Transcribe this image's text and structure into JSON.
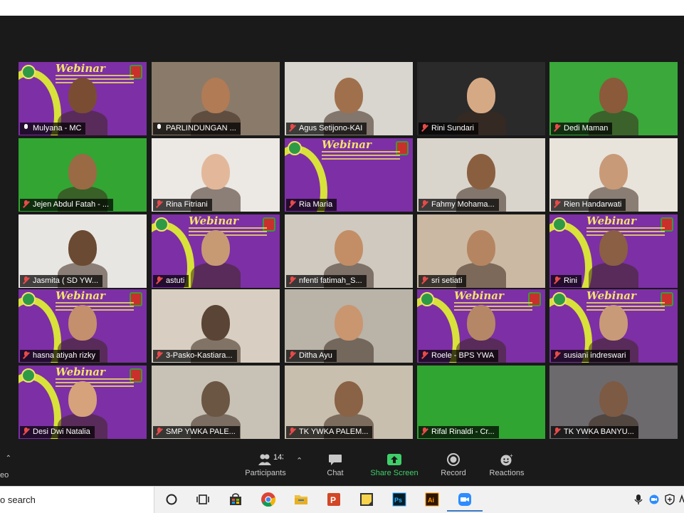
{
  "participants": [
    {
      "name": "Mulyana - MC",
      "mic": "on",
      "bg": "#7d2fa5",
      "face": "#7a4d33",
      "active": true,
      "webinar": true
    },
    {
      "name": "PARLINDUNGAN ...",
      "mic": "on",
      "bg": "#8a7a6a",
      "face": "#b07b55",
      "active": false,
      "webinar": false
    },
    {
      "name": "Agus Setijono-KAI",
      "mic": "muted",
      "bg": "#d8d6cf",
      "face": "#a0704c",
      "active": false,
      "webinar": false
    },
    {
      "name": "Rini Sundari",
      "mic": "muted",
      "bg": "#2a2a2a",
      "face": "#d6a985",
      "active": false,
      "webinar": false
    },
    {
      "name": "Dedi Maman",
      "mic": "muted",
      "bg": "#3aa83a",
      "face": "#8a5a3a",
      "active": false,
      "webinar": false
    },
    {
      "name": "Jejen Abdul Fatah - ...",
      "mic": "muted",
      "bg": "#33a533",
      "face": "#9a6a44",
      "active": false,
      "webinar": false
    },
    {
      "name": "Rina Fitriani",
      "mic": "muted",
      "bg": "#ece8e4",
      "face": "#e3b89a",
      "active": false,
      "webinar": false
    },
    {
      "name": "Ria Maria",
      "mic": "muted",
      "bg": "#7d2fa5",
      "face": null,
      "active": false,
      "webinar": true
    },
    {
      "name": "Fahmy Mohama...",
      "mic": "muted",
      "bg": "#d9d5cc",
      "face": "#8a5f40",
      "active": false,
      "webinar": false
    },
    {
      "name": "Rien Handarwati",
      "mic": "muted",
      "bg": "#e8e4dc",
      "face": "#c99a78",
      "active": false,
      "webinar": false
    },
    {
      "name": "Jasmita ( SD YW...",
      "mic": "muted",
      "bg": "#e8e6e2",
      "face": "#6b4a33",
      "active": false,
      "webinar": false
    },
    {
      "name": "astuti",
      "mic": "muted",
      "bg": "#7d2fa5",
      "face": "#c79a74",
      "active": false,
      "webinar": true
    },
    {
      "name": "nfenti fatimah_S...",
      "mic": "muted",
      "bg": "#cfc9c0",
      "face": "#c38e66",
      "active": false,
      "webinar": false
    },
    {
      "name": "sri setiati",
      "mic": "muted",
      "bg": "#cbb9a3",
      "face": "#b58561",
      "active": false,
      "webinar": false
    },
    {
      "name": "Rini",
      "mic": "muted",
      "bg": "#7d2fa5",
      "face": "#8a5f44",
      "active": false,
      "webinar": true
    },
    {
      "name": "hasna atiyah rizky",
      "mic": "muted",
      "bg": "#7d2fa5",
      "face": "#c48f6c",
      "active": false,
      "webinar": true
    },
    {
      "name": "3-Pasko-Kastiara...",
      "mic": "muted",
      "bg": "#d8cfc2",
      "face": "#5a4436",
      "active": false,
      "webinar": false
    },
    {
      "name": "Ditha Ayu",
      "mic": "muted",
      "bg": "#b9b3a8",
      "face": "#c99670",
      "active": false,
      "webinar": false
    },
    {
      "name": "Roele -  BPS YWA",
      "mic": "muted",
      "bg": "#7d2fa5",
      "face": "#b58766",
      "active": false,
      "webinar": true
    },
    {
      "name": "susiani indreswari",
      "mic": "muted",
      "bg": "#7d2fa5",
      "face": "#c99a78",
      "active": false,
      "webinar": true
    },
    {
      "name": "Desi Dwi Natalia",
      "mic": "muted",
      "bg": "#7d2fa5",
      "face": "#d6a27c",
      "active": false,
      "webinar": true
    },
    {
      "name": "SMP YWKA PALE...",
      "mic": "muted",
      "bg": "#c8c2b6",
      "face": "#6b5644",
      "active": false,
      "webinar": false
    },
    {
      "name": "TK YWKA PALEM...",
      "mic": "muted",
      "bg": "#c9bfae",
      "face": "#8a6246",
      "active": false,
      "webinar": false
    },
    {
      "name": "Rifal Rinaldi - Cr...",
      "mic": "muted",
      "bg": "#31a531",
      "face": null,
      "active": false,
      "webinar": false
    },
    {
      "name": "TK YWKA BANYU...",
      "mic": "muted",
      "bg": "#6d6a6e",
      "face": "#7d5a44",
      "active": false,
      "webinar": false
    }
  ],
  "webinar_title": "Webinar",
  "toolbar": {
    "left_partial": "eo",
    "participants_count": "143",
    "participants_label": "Participants",
    "chat_label": "Chat",
    "share_label": "Share Screen",
    "record_label": "Record",
    "reactions_label": "Reactions"
  },
  "taskbar": {
    "search_text": "o search",
    "apps": [
      "task-view-icon",
      "store-icon",
      "chrome-icon",
      "file-explorer-icon",
      "powerpoint-icon",
      "sticky-notes-icon",
      "photoshop-icon",
      "illustrator-icon",
      "zoom-icon"
    ],
    "tray": [
      "microphone-icon",
      "zoom-tray-icon",
      "security-icon",
      "language-icon"
    ]
  },
  "colors": {
    "zoom_bg": "#1a1a1a",
    "active_speaker": "#f2e36b",
    "share_green": "#3fcf69",
    "muted_red": "#e84a4a",
    "webinar_purple": "#7d2fa5"
  }
}
